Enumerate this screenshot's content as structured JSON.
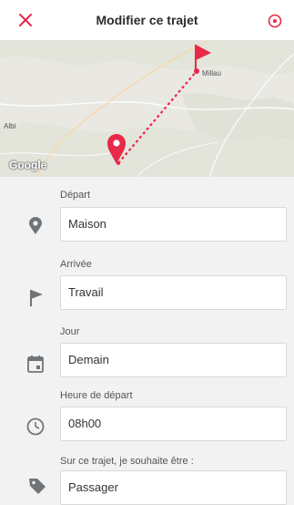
{
  "header": {
    "title": "Modifier ce trajet",
    "close_icon": "close-icon",
    "menu_icon": "circle-dot-icon",
    "accent_color": "#e8294a"
  },
  "map": {
    "labels": {
      "millau": "Millau",
      "albi": "Albi"
    },
    "logo_text": "Google",
    "route_color": "#e8294a"
  },
  "form": {
    "fields": [
      {
        "label": "Départ",
        "value": "Maison",
        "icon": "map-pin-icon"
      },
      {
        "label": "Arrivée",
        "value": "Travail",
        "icon": "flag-icon"
      },
      {
        "label": "Jour",
        "value": "Demain",
        "icon": "calendar-icon"
      },
      {
        "label": "Heure de départ",
        "value": "08h00",
        "icon": "clock-icon"
      },
      {
        "label": "Sur ce trajet, je souhaite être :",
        "value": "Passager",
        "icon": "tag-icon"
      }
    ]
  }
}
